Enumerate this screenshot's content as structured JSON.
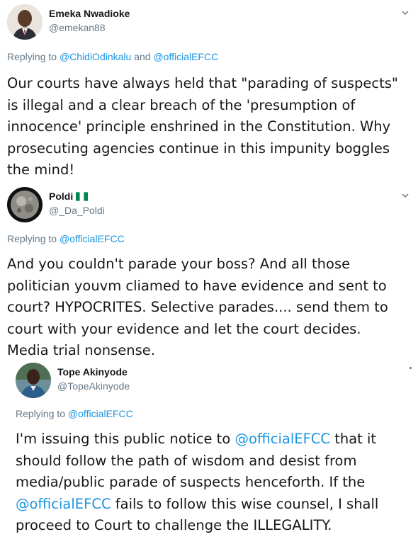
{
  "tweets": [
    {
      "name": "Emeka Nwadioke",
      "handle": "@emekan88",
      "reply_prefix": "Replying to ",
      "reply_mention1": "@ChidiOdinkalu",
      "reply_and": " and ",
      "reply_mention2": "@officialEFCC",
      "text_lines": [
        "Our courts have always held that \"parading of suspects\"",
        "is illegal and a clear breach of the 'presumption of",
        "innocence' principle enshrined in the Constitution. Why",
        "prosecuting agencies continue in this impunity boggles",
        "the mind!"
      ]
    },
    {
      "name": "Poldi",
      "handle": "@_Da_Poldi",
      "reply_prefix": "Replying to ",
      "reply_mention1": "@officialEFCC",
      "text_lines": [
        "And you couldn't parade your boss? And all those",
        "politician youvm cliamed to have evidence and sent to",
        "court? HYPOCRITES. Selective parades.... send them to",
        "court with your evidence and let the court decides.",
        "Media trial nonsense."
      ]
    },
    {
      "name": "Tope Akinyode",
      "handle": "@TopeAkinyode",
      "reply_prefix": "Replying to ",
      "reply_mention1": "@officialEFCC",
      "line1_pre": "I'm issuing this public notice to ",
      "line1_mention": "@officialEFCC",
      "line1_post": " that it",
      "line2": "should follow the path of wisdom and desist from",
      "line3": "media/public parade of suspects henceforth. If the",
      "line4_mention": "@officialEFCC",
      "line4_post": " fails to follow this wise counsel, I shall",
      "line5": "proceed to Court to challenge the ILLEGALITY."
    }
  ],
  "colors": {
    "mention": "#1b95e0",
    "secondary": "#657786",
    "text": "#14171a",
    "flag_green": "#008751"
  },
  "icons": {
    "more": "chevron-down-icon",
    "flag": "nigeria-flag-icon"
  }
}
